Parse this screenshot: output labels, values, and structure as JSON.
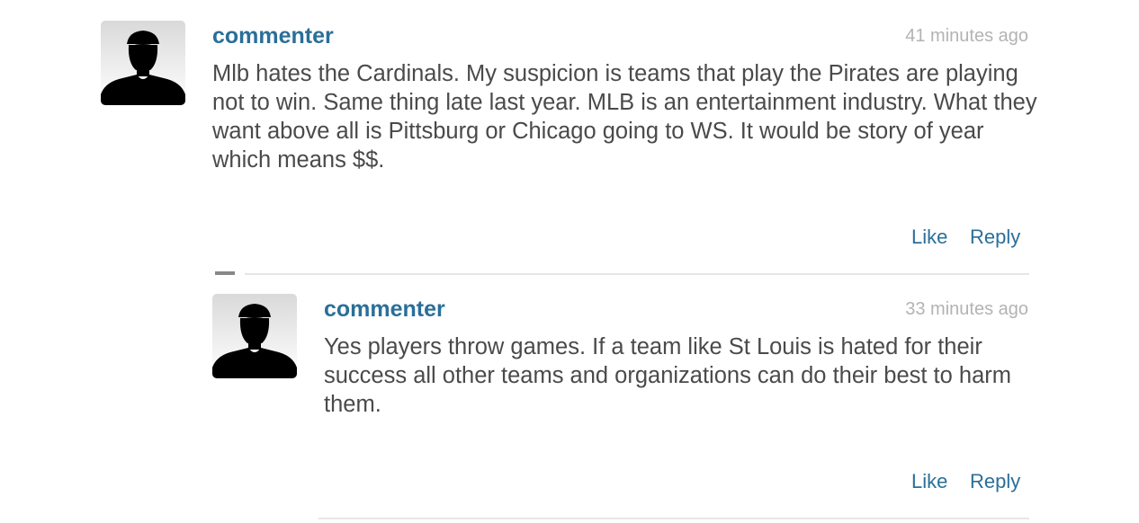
{
  "comments": [
    {
      "author": "commenter",
      "time": "41 minutes ago",
      "text": "Mlb hates the Cardinals. My suspicion is teams that play the Pirates are playing not to win. Same thing late last year. MLB is an entertainment industry. What they want above all is Pittsburg or Chicago going to WS. It would be story of year which means $$.",
      "like_label": "Like",
      "reply_label": "Reply"
    },
    {
      "author": "commenter",
      "time": "33 minutes ago",
      "text": "Yes players throw games. If a team like St Louis is hated for their success all other teams and organizations can do their best to harm them.",
      "like_label": "Like",
      "reply_label": "Reply"
    }
  ],
  "icons": {
    "avatar": "default-user-silhouette-icon",
    "collapse": "minus-icon"
  },
  "colors": {
    "author": "#2a6f99",
    "timestamp": "#b3b3b3",
    "body": "#4a4a4a",
    "link": "#2a6f99",
    "divider": "#e6e6e6"
  }
}
